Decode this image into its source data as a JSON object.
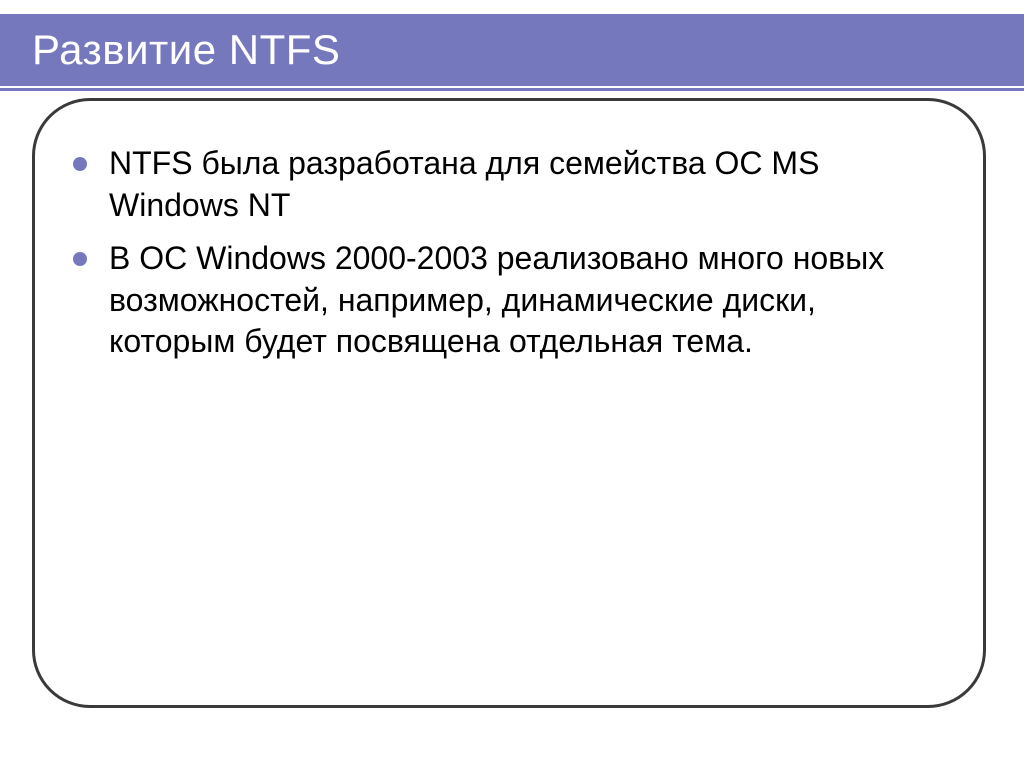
{
  "title": "Развитие NTFS",
  "colors": {
    "accent": "#7578bd",
    "border": "#3a3a3a",
    "text": "#000000",
    "titleText": "#ffffff"
  },
  "bullets": [
    "NTFS была разработана для семейства ОС MS Windows NT",
    "В ОС Windows 2000-2003 реализовано много новых возможностей, например, динамические диски, которым будет посвящена отдельная тема."
  ]
}
